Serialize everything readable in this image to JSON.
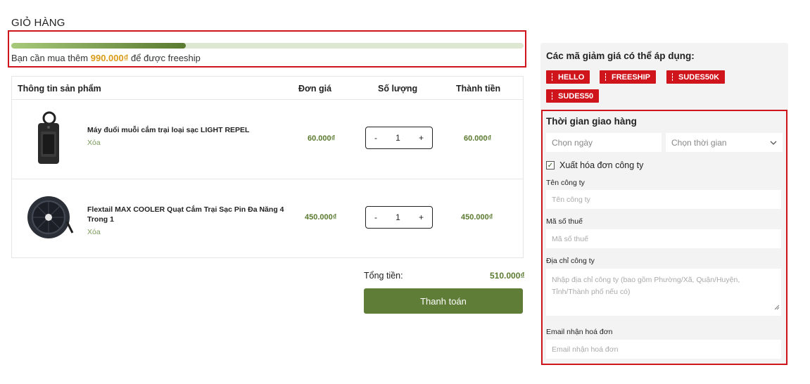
{
  "page": {
    "title": "GIỎ HÀNG"
  },
  "freeship": {
    "progress_percent": 34,
    "text_before": "Bạn cần mua thêm ",
    "amount": "990.000₫",
    "text_after": " để được freeship"
  },
  "table": {
    "headers": {
      "product": "Thông tin sản phẩm",
      "unit_price": "Đơn giá",
      "quantity": "Số lượng",
      "subtotal": "Thành tiền"
    },
    "items": [
      {
        "name": "Máy đuổi muỗi cắm trại loại sạc LIGHT REPEL",
        "remove_label": "Xóa",
        "unit_price": "60.000₫",
        "qty_minus": "-",
        "quantity": "1",
        "qty_plus": "+",
        "subtotal": "60.000₫",
        "image_icon": "mosquito-repeller-icon"
      },
      {
        "name": "Flextail MAX COOLER Quạt Cắm Trại Sạc Pin Đa Năng 4 Trong 1",
        "remove_label": "Xóa",
        "unit_price": "450.000₫",
        "qty_minus": "-",
        "quantity": "1",
        "qty_plus": "+",
        "subtotal": "450.000₫",
        "image_icon": "fan-icon"
      }
    ]
  },
  "summary": {
    "total_label": "Tổng tiền:",
    "total_value": "510.000₫",
    "checkout_label": "Thanh toán"
  },
  "coupons": {
    "title": "Các mã giảm giá có thể áp dụng:",
    "codes": [
      "HELLO",
      "FREESHIP",
      "SUDES50K",
      "SUDES50"
    ]
  },
  "delivery": {
    "title": "Thời gian giao hàng",
    "date_placeholder": "Chọn ngày",
    "time_placeholder": "Chọn thời gian",
    "invoice_checkbox_label": "Xuất hóa đơn công ty",
    "invoice_checked": true,
    "company_name_label": "Tên công ty",
    "company_name_placeholder": "Tên công ty",
    "tax_code_label": "Mã số thuế",
    "tax_code_placeholder": "Mã số thuế",
    "address_label": "Địa chỉ công ty",
    "address_placeholder": "Nhập địa chỉ công ty (bao gồm Phường/Xã, Quận/Huyện, Tỉnh/Thành phố nếu có)",
    "email_label": "Email nhận hoá đơn",
    "email_placeholder": "Email nhận hoá đơn"
  },
  "colors": {
    "accent_green": "#5f7d37",
    "highlight_red": "#d0141c",
    "freeship_amount": "#d99b18",
    "coupon_red": "#d0141c"
  }
}
